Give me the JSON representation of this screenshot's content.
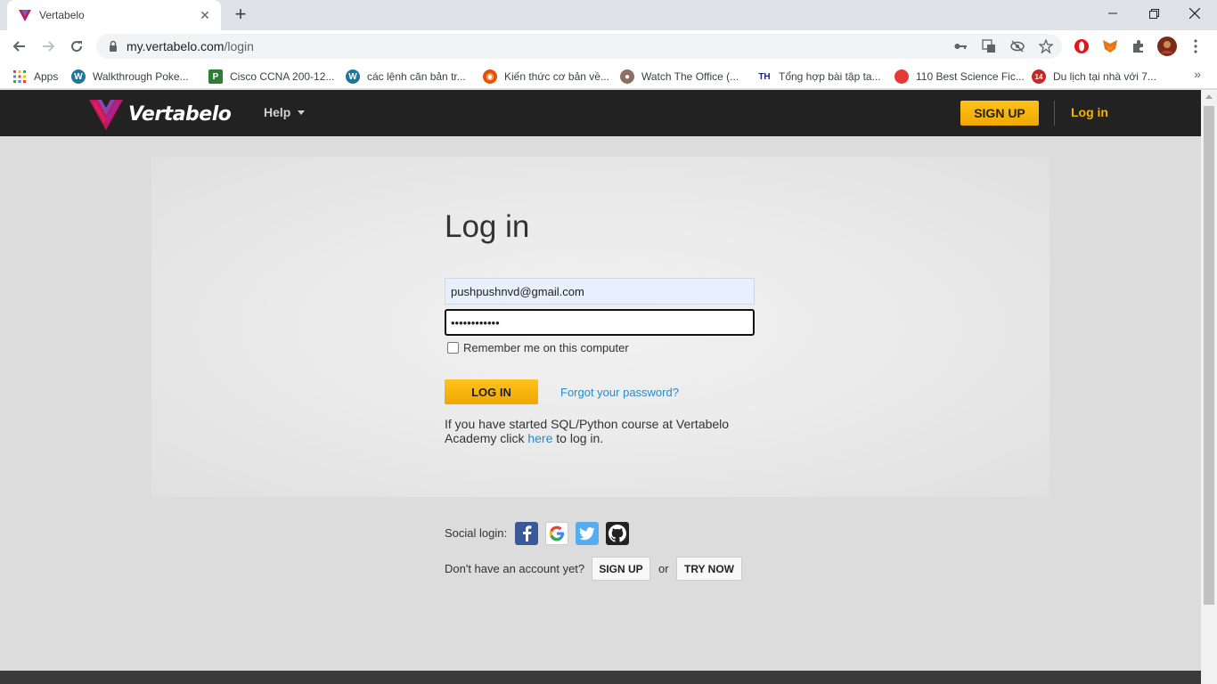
{
  "browser": {
    "tab_title": "Vertabelo",
    "url_host": "my.vertabelo.com",
    "url_path": "/login",
    "bookmarks": [
      {
        "label": "Apps",
        "icon": "apps-grid-icon"
      },
      {
        "label": "Walkthrough Poke...",
        "icon": "wordpress-icon"
      },
      {
        "label": "Cisco CCNA 200-12...",
        "icon": "site-icon"
      },
      {
        "label": "các lệnh căn bản tr...",
        "icon": "wordpress-icon"
      },
      {
        "label": "Kiến thức cơ bản về...",
        "icon": "site-icon"
      },
      {
        "label": "Watch The Office (...",
        "icon": "avatar-icon"
      },
      {
        "label": "Tổng hợp bài tập ta...",
        "icon": "th-icon"
      },
      {
        "label": "110 Best Science Fic...",
        "icon": "tomato-icon"
      },
      {
        "label": "Du lịch tại nhà với 7...",
        "icon": "site-icon"
      }
    ],
    "overflow": "»"
  },
  "header": {
    "logo_text": "Vertabelo",
    "help_label": "Help",
    "signup_label": "SIGN UP",
    "login_label": "Log in"
  },
  "login": {
    "title": "Log in",
    "email_value": "pushpushnvd@gmail.com",
    "password_value": "••••••••••••",
    "remember_label": "Remember me on this computer",
    "login_button": "LOG IN",
    "forgot_link": "Forgot your password?",
    "academy_text_1": "If you have started SQL/Python course at Vertabelo Academy click ",
    "academy_link": "here",
    "academy_text_2": " to log in."
  },
  "social": {
    "label": "Social login:",
    "providers": [
      "facebook",
      "google",
      "twitter",
      "github"
    ],
    "no_account": "Don't have an account yet?",
    "signup_button": "SIGN UP",
    "or_text": "or",
    "try_button": "TRY NOW"
  },
  "colors": {
    "accent": "#f5b400",
    "header_bg": "#222222",
    "link": "#2a8ac4"
  }
}
